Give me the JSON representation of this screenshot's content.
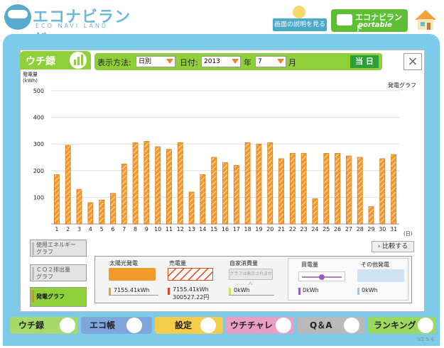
{
  "header": {
    "logo_main": "エコナビランド",
    "logo_sub": "ECO NAVI LAND",
    "help_label": "画面の説明を見る",
    "portable_title": "エコナビランド",
    "portable_sub": "portable"
  },
  "toolbar": {
    "tab_label": "ウチ録",
    "display_method_label": "表示方法:",
    "display_method_value": "日別",
    "date_label": "日付:",
    "year_value": "2013",
    "year_label": "年",
    "month_value": "7",
    "month_label": "月",
    "today_label": "当 日",
    "close_label": "×"
  },
  "chart_data": {
    "type": "bar",
    "title": "発電グラフ",
    "ylabel": "発電量\n(kWh)",
    "xlabel": "(日)",
    "ylim": [
      0,
      500
    ],
    "yticks": [
      100,
      200,
      300,
      400,
      500
    ],
    "categories": [
      "1",
      "2",
      "3",
      "4",
      "5",
      "6",
      "7",
      "8",
      "9",
      "10",
      "11",
      "12",
      "13",
      "14",
      "15",
      "16",
      "17",
      "18",
      "19",
      "20",
      "21",
      "22",
      "23",
      "24",
      "25",
      "26",
      "27",
      "28",
      "29",
      "30",
      "31"
    ],
    "values": [
      185,
      295,
      130,
      80,
      90,
      115,
      225,
      305,
      310,
      290,
      280,
      305,
      120,
      185,
      250,
      230,
      220,
      305,
      300,
      305,
      245,
      265,
      265,
      95,
      265,
      265,
      255,
      250,
      65,
      245,
      260
    ],
    "bar_color": "#f39a2d"
  },
  "left_buttons": [
    {
      "label": "使用エネルギー\nグラフ",
      "active": false
    },
    {
      "label": "ＣＯ２排出量\nグラフ",
      "active": false
    },
    {
      "label": "発電グラフ",
      "active": true
    }
  ],
  "compare_label": "比較する",
  "legend": {
    "solar_label": "太陽光発電",
    "solar_value": "7155.41kWh",
    "sell_label": "売電量",
    "sell_value": "7155.41kWh",
    "sell_yen": "300527.22円",
    "self_label": "自家消費量",
    "self_note": "グラフは表示されません",
    "self_value": "0kWh",
    "buy_label": "買電量",
    "buy_value": "0kWh",
    "other_label": "その他発電",
    "other_value": "0kWh"
  },
  "bottom_tabs": [
    {
      "label": "ウチ録",
      "icon": "bar-chart-icon"
    },
    {
      "label": "エコ帳",
      "icon": "notebook-icon"
    },
    {
      "label": "設定",
      "icon": "wrench-icon"
    },
    {
      "label": "ウチチャレ",
      "icon": "flag-icon"
    },
    {
      "label": "Q＆A",
      "icon": "question-icon"
    },
    {
      "label": "ランキング",
      "icon": "crown-icon"
    }
  ],
  "version": "V2.5.4",
  "colors": {
    "accent_green": "#8fcf3a",
    "sky_blue": "#7dcbe8",
    "orange": "#f39a2d",
    "sell_red": "#e04a1f"
  }
}
